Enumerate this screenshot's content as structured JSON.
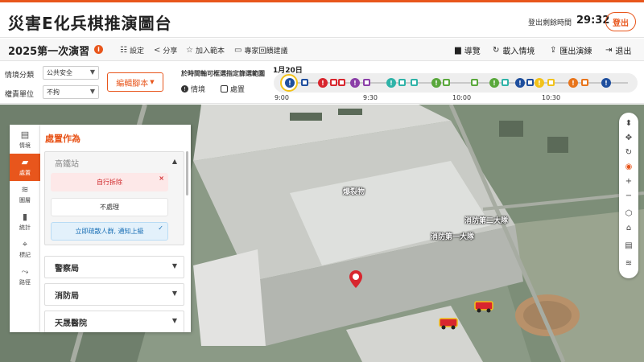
{
  "app": {
    "title": "災害E化兵棋推演圖台",
    "countdown_label": "登出剩餘時間",
    "countdown_value": "29:32",
    "logout_label": "登出"
  },
  "subbar": {
    "drill_title": "2025第一次演習",
    "info_icon": "info-icon",
    "actions": [
      {
        "label": "設定",
        "icon": "settings-icon"
      },
      {
        "label": "分享",
        "icon": "share-icon"
      },
      {
        "label": "加入範本",
        "icon": "star-icon"
      },
      {
        "label": "專家回饋建議",
        "icon": "chat-icon"
      }
    ],
    "right_actions": [
      {
        "label": "導覽",
        "icon": "book-icon"
      },
      {
        "label": "載入情境",
        "icon": "reload-icon"
      },
      {
        "label": "匯出演練",
        "icon": "export-icon"
      },
      {
        "label": "退出",
        "icon": "exit-icon"
      }
    ]
  },
  "filters": {
    "category_label": "情境分類",
    "category_value": "公共安全",
    "unit_label": "權責單位",
    "unit_value": "不拘",
    "edit_script_label": "編輯腳本",
    "hint": "於時間軸可框選指定篩選範圍",
    "legend_scenario": "情境",
    "legend_action": "處置"
  },
  "timeline": {
    "date": "1月20日",
    "ticks": [
      "9:00",
      "9:30",
      "10:00",
      "10:30"
    ],
    "colors": {
      "blue": "#1f4f9e",
      "red": "#d8262e",
      "purple": "#8b3fa8",
      "teal": "#2fb3a8",
      "green": "#5aa83c",
      "yellow": "#f2c21a",
      "orange": "#e8751c"
    }
  },
  "leftnav": [
    {
      "label": "情境",
      "icon": "document-icon"
    },
    {
      "label": "處置",
      "icon": "chat-bubble-icon"
    },
    {
      "label": "圖層",
      "icon": "layers-icon"
    },
    {
      "label": "統計",
      "icon": "bar-chart-icon"
    },
    {
      "label": "標記",
      "icon": "pin-icon"
    },
    {
      "label": "路徑",
      "icon": "route-icon"
    }
  ],
  "panel": {
    "title": "處置作為",
    "open_section": "高鐵站",
    "options": [
      {
        "label": "自行拆除",
        "mark": "×"
      },
      {
        "label": "不處理",
        "mark": ""
      },
      {
        "label": "立即疏散人群, 通知上級",
        "mark": "✓"
      }
    ],
    "sections": [
      "警察局",
      "消防局",
      "天晟醫院"
    ]
  },
  "map": {
    "labels": [
      "爆裂物",
      "消防第一大隊",
      "消防第二大隊"
    ]
  },
  "tools": [
    "compass-icon",
    "pan-icon",
    "rotate-icon",
    "locate-icon",
    "zoom-in-icon",
    "zoom-out-icon",
    "cube-icon",
    "hat-icon",
    "document-icon",
    "layers-icon"
  ]
}
